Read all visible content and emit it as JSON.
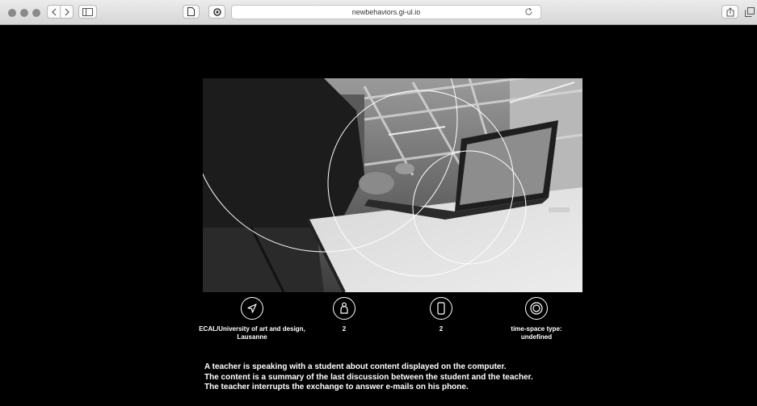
{
  "browser": {
    "url": "newbehaviors.gi-ul.io",
    "icons": [
      "back-icon",
      "forward-icon",
      "sidebar-icon",
      "page-icon",
      "reader-icon",
      "reload-icon",
      "share-icon",
      "tabs-icon"
    ]
  },
  "info": [
    {
      "icon": "location-arrow-icon",
      "label": "ECAL/University of art and design, Lausanne"
    },
    {
      "icon": "person-icon",
      "label": "2"
    },
    {
      "icon": "phone-icon",
      "label": "2"
    },
    {
      "icon": "concentric-circles-icon",
      "label": "time-space type: undefined"
    }
  ],
  "description": {
    "line1": "A teacher is speaking with a student about content displayed on the computer.",
    "line2": "The content is a summary of the last discussion between the student and the teacher.",
    "line3": "The teacher interrupts the exchange to answer e-mails on his phone."
  },
  "colors": {
    "background": "#000000",
    "text": "#ffffff",
    "chrome": "#e4e4e4"
  }
}
